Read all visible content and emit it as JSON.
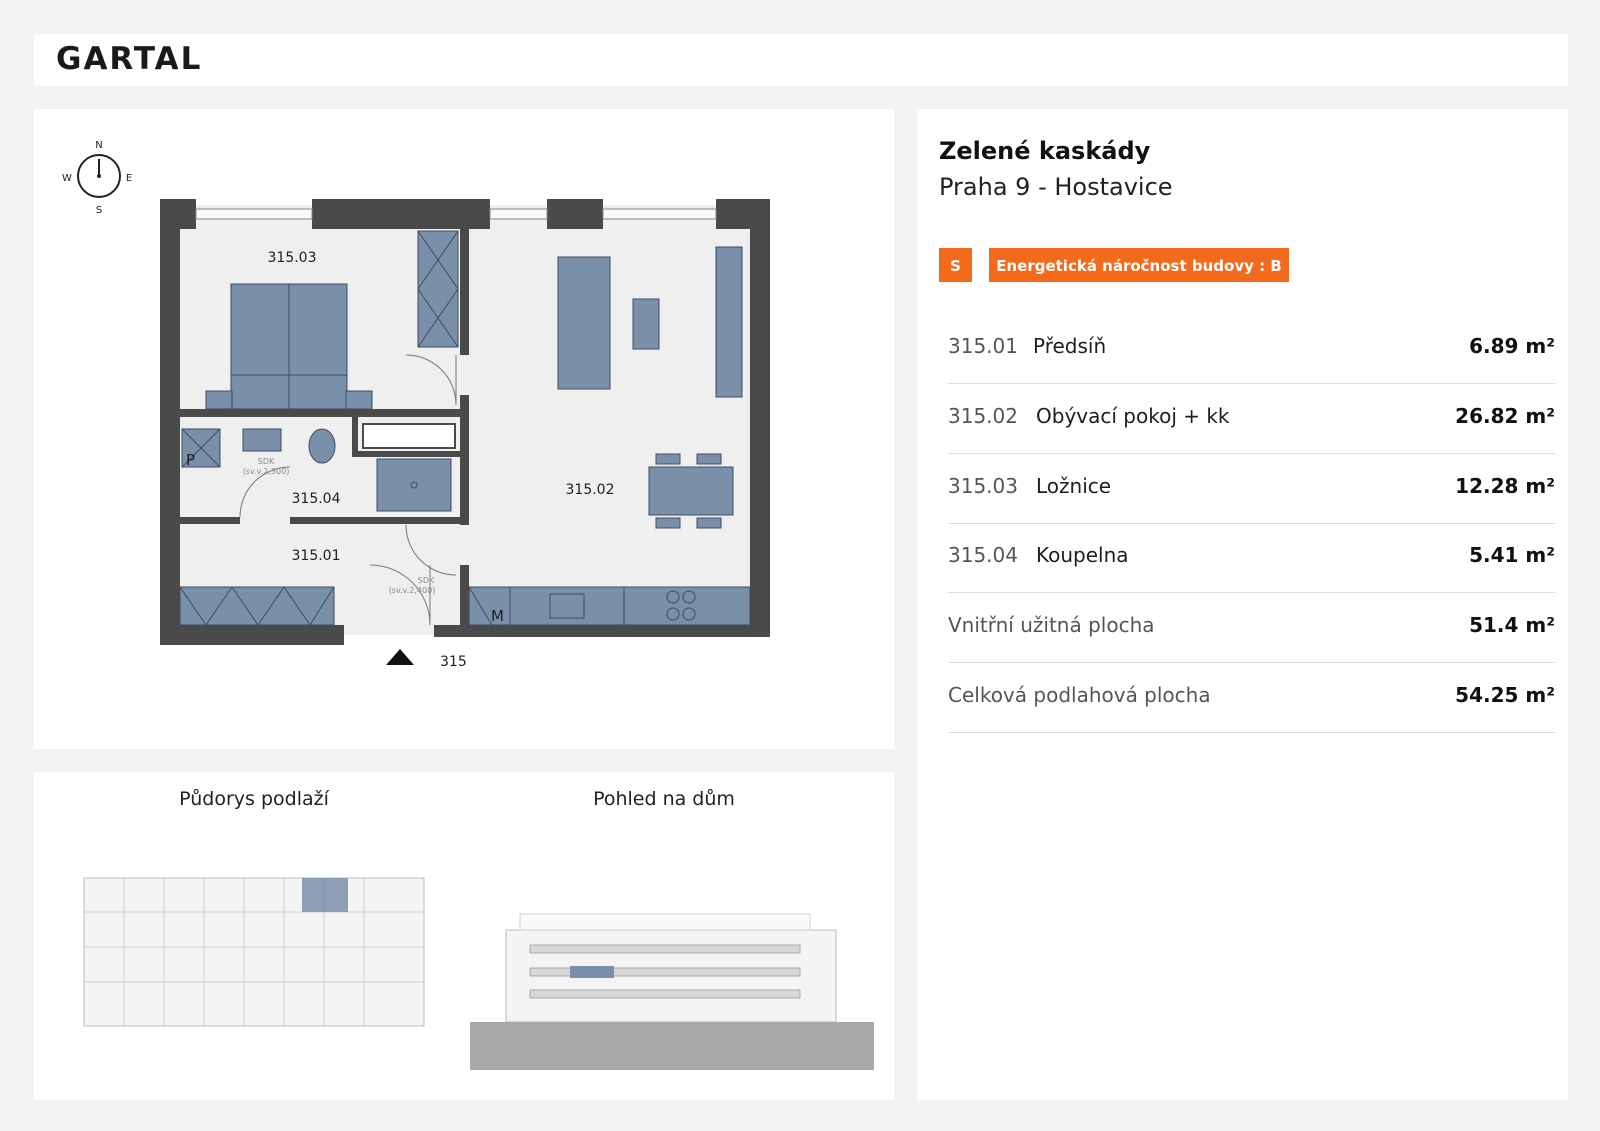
{
  "header": {
    "logo": "GARTAL"
  },
  "plan": {
    "compass": {
      "n": "N",
      "s": "S",
      "w": "W",
      "e": "E"
    },
    "rooms": {
      "r1": "315.01",
      "r2": "315.02",
      "r3": "315.03",
      "r4": "315.04"
    },
    "marks": {
      "p": "P",
      "m": "M",
      "sdk1": "SDK",
      "sdk1_h": "(sv.v.2,300)",
      "sdk2": "SDK",
      "sdk2_h": "(sv.v.2,400)"
    },
    "unit_number": "315"
  },
  "thumbnails": {
    "floor_plan_title": "Půdorys podlaží",
    "house_view_title": "Pohled na dům"
  },
  "info": {
    "project_name": "Zelené kaskády",
    "location": "Praha 9 - Hostavice",
    "badge_s": "S",
    "energy_label": "Energetická náročnost budovy : B",
    "rooms": [
      {
        "code": "315.01",
        "name": "Předsíň",
        "area": "6.89 m²"
      },
      {
        "code": "315.02",
        "name": "Obývací pokoj + kk",
        "area": "26.82 m²"
      },
      {
        "code": "315.03",
        "name": "Ložnice",
        "area": "12.28 m²"
      },
      {
        "code": "315.04",
        "name": "Koupelna",
        "area": "5.41 m²"
      }
    ],
    "totals": [
      {
        "label": "Vnitřní užitná plocha",
        "area": "51.4 m²"
      },
      {
        "label": "Celková podlahová plocha",
        "area": "54.25 m²"
      }
    ]
  },
  "colors": {
    "accent": "#f26a1b",
    "wall": "#4a4a4a",
    "furniture": "#7a8fa8",
    "floor": "#efefef",
    "background": "#f2f3f5"
  }
}
